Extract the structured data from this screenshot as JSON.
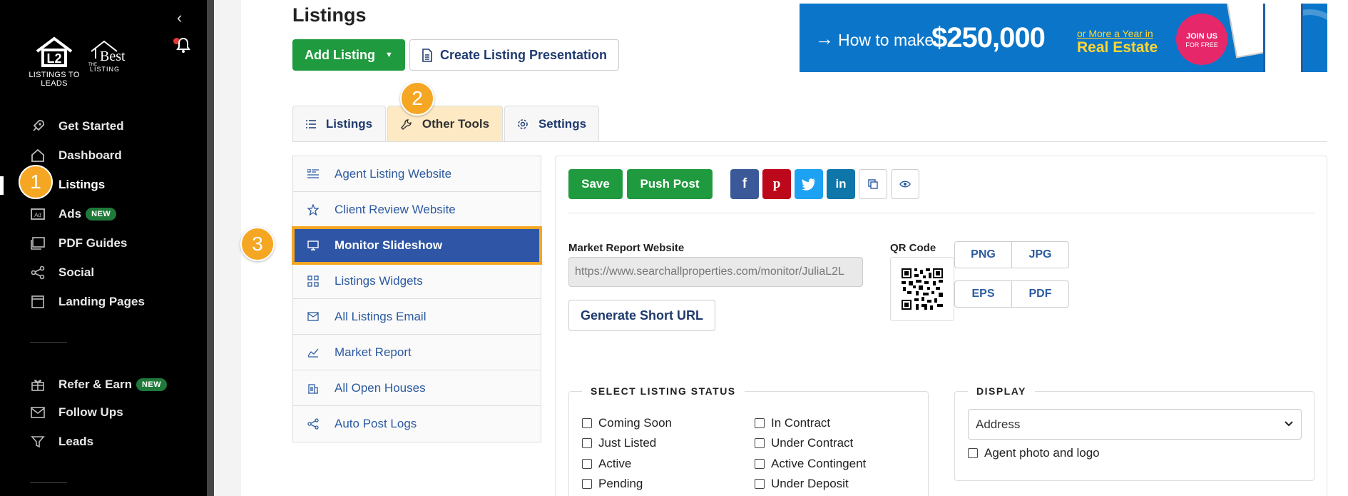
{
  "sidebar": {
    "logo1_caption": "LISTINGS TO LEADS",
    "logo2_the": "THE",
    "logo2_best": "Best",
    "logo2_listing": "LISTING",
    "items": [
      {
        "label": "Get Started",
        "icon": "rocket-icon"
      },
      {
        "label": "Dashboard",
        "icon": "home-icon"
      },
      {
        "label": "Listings",
        "icon": "listings-icon"
      },
      {
        "label": "Ads",
        "icon": "ad-icon",
        "badge": "NEW"
      },
      {
        "label": "PDF Guides",
        "icon": "pdf-icon"
      },
      {
        "label": "Social",
        "icon": "share-icon"
      },
      {
        "label": "Landing Pages",
        "icon": "page-icon"
      },
      {
        "label": "Refer & Earn",
        "icon": "gift-icon",
        "badge": "NEW"
      },
      {
        "label": "Follow Ups",
        "icon": "mail-icon"
      },
      {
        "label": "Leads",
        "icon": "filter-icon"
      }
    ]
  },
  "steps": {
    "s1": "1",
    "s2": "2",
    "s3": "3"
  },
  "header": {
    "title": "Listings",
    "add_listing": "Add Listing",
    "create_presentation": "Create Listing Presentation"
  },
  "banner": {
    "how_to": "How to make",
    "amount": "$250,000",
    "or_more": "or More a Year in",
    "real_estate": "Real Estate",
    "join_us": "JOIN US",
    "for_free": "FOR FREE"
  },
  "tabs": [
    {
      "label": "Listings"
    },
    {
      "label": "Other Tools"
    },
    {
      "label": "Settings"
    }
  ],
  "tools": [
    {
      "label": "Agent Listing Website"
    },
    {
      "label": "Client Review Website"
    },
    {
      "label": "Monitor Slideshow"
    },
    {
      "label": "Listings Widgets"
    },
    {
      "label": "All Listings Email"
    },
    {
      "label": "Market Report"
    },
    {
      "label": "All Open Houses"
    },
    {
      "label": "Auto Post Logs"
    }
  ],
  "panel": {
    "save": "Save",
    "push_post": "Push Post",
    "market_report_label": "Market Report Website",
    "market_report_url": "https://www.searchallproperties.com/monitor/JuliaL2L",
    "generate_short_url": "Generate Short URL",
    "qr_label": "QR Code",
    "formats": [
      "PNG",
      "JPG",
      "EPS",
      "PDF"
    ],
    "status_legend": "SELECT LISTING STATUS",
    "statuses_left": [
      "Coming Soon",
      "Just Listed",
      "Active",
      "Pending"
    ],
    "statuses_right": [
      "In Contract",
      "Under Contract",
      "Active Contingent",
      "Under Deposit"
    ],
    "display_legend": "DISPLAY",
    "display_value": "Address",
    "agent_photo": "Agent photo and logo"
  },
  "colors": {
    "green": "#1f9a3e",
    "navy": "#2f56a6",
    "accent": "#f5a623",
    "facebook": "#3b5998",
    "pinterest": "#bd081c",
    "twitter": "#1da1f2",
    "linkedin": "#0e76a8"
  }
}
